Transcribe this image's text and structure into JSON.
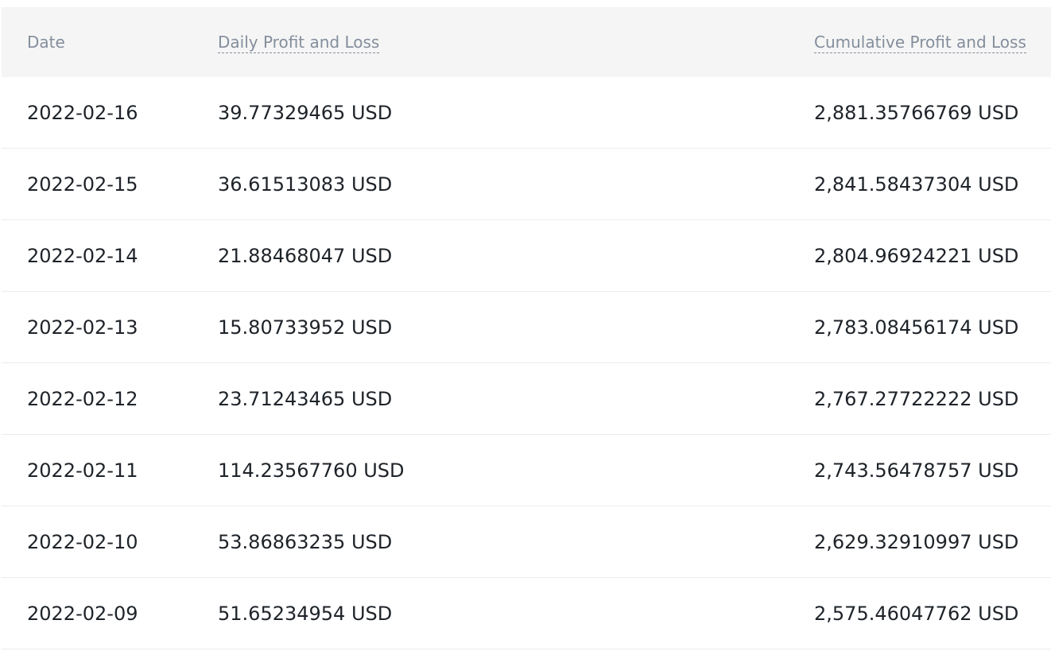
{
  "table": {
    "headers": {
      "date": "Date",
      "daily": "Daily Profit and Loss",
      "cumulative": "Cumulative Profit and Loss"
    },
    "rows": [
      {
        "date": "2022-02-16",
        "daily": "39.77329465 USD",
        "cumulative": "2,881.35766769 USD"
      },
      {
        "date": "2022-02-15",
        "daily": "36.61513083 USD",
        "cumulative": "2,841.58437304 USD"
      },
      {
        "date": "2022-02-14",
        "daily": "21.88468047 USD",
        "cumulative": "2,804.96924221 USD"
      },
      {
        "date": "2022-02-13",
        "daily": "15.80733952 USD",
        "cumulative": "2,783.08456174 USD"
      },
      {
        "date": "2022-02-12",
        "daily": "23.71243465 USD",
        "cumulative": "2,767.27722222 USD"
      },
      {
        "date": "2022-02-11",
        "daily": "114.23567760 USD",
        "cumulative": "2,743.56478757 USD"
      },
      {
        "date": "2022-02-10",
        "daily": "53.86863235 USD",
        "cumulative": "2,629.32910997 USD"
      },
      {
        "date": "2022-02-09",
        "daily": "51.65234954 USD",
        "cumulative": "2,575.46047762 USD"
      }
    ]
  },
  "colors": {
    "header_bg": "#f5f5f5",
    "header_text": "#848e9c",
    "body_text": "#1e2329",
    "row_divider": "#eaecef"
  }
}
